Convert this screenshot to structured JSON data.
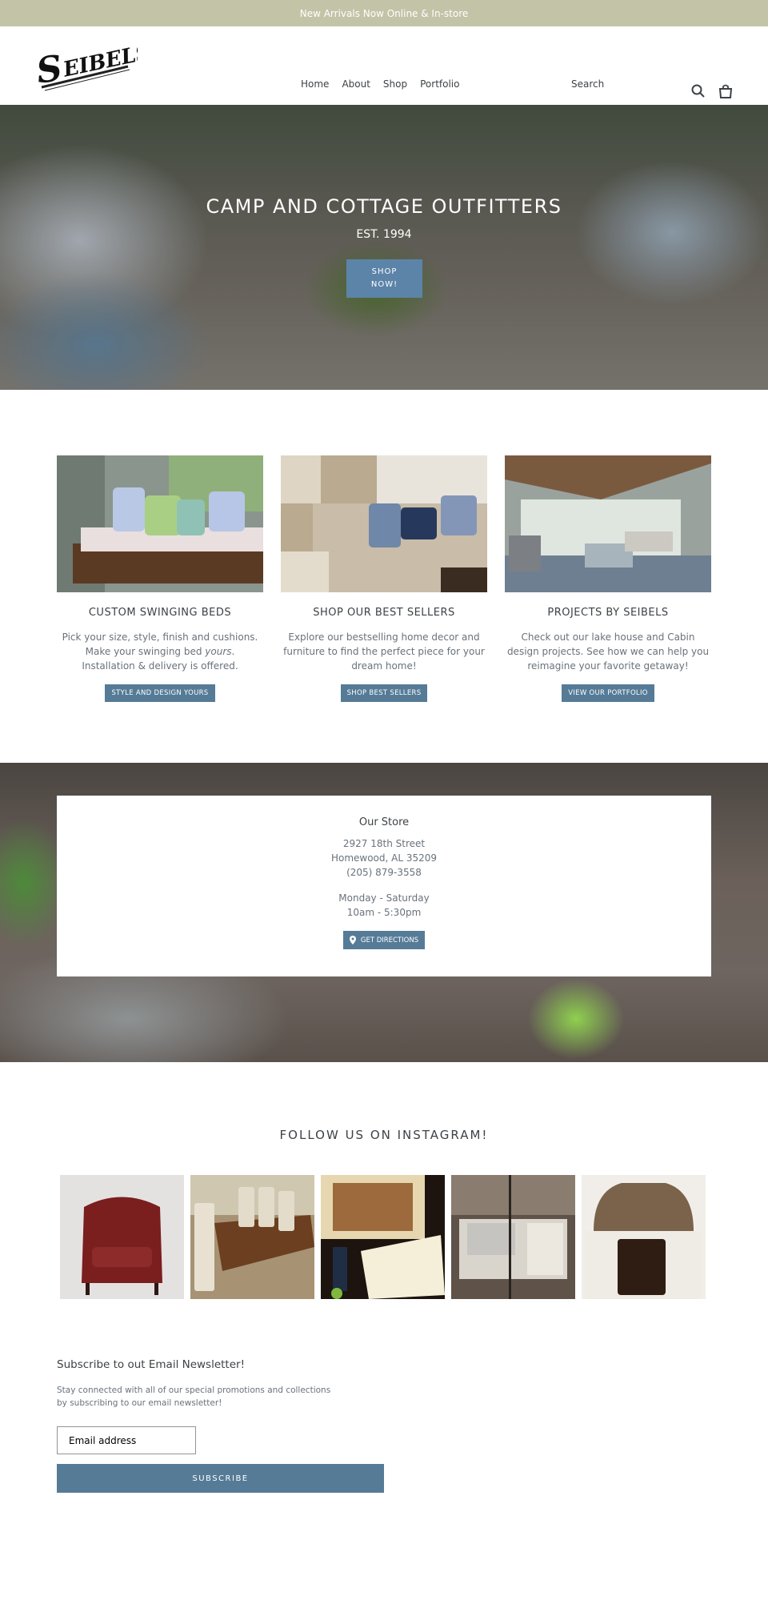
{
  "announcement": "New Arrivals Now Online & In-store",
  "header": {
    "logo_text": "Seibels",
    "nav": [
      "Home",
      "About",
      "Shop",
      "Portfolio"
    ],
    "search_label": "Search",
    "icons": [
      "search-icon",
      "cart-icon"
    ]
  },
  "hero": {
    "title": "CAMP AND COTTAGE OUTFITTERS",
    "subtitle": "EST. 1994",
    "button_line1": "SHOP",
    "button_line2": "NOW!"
  },
  "features": [
    {
      "title": "CUSTOM SWINGING BEDS",
      "text_before": "Pick your size, style, finish and cushions. Make your swinging bed ",
      "text_em": "yours",
      "text_after": ". Installation & delivery is offered.",
      "button": "STYLE AND DESIGN YOURS",
      "image": "swinging bed with pillows"
    },
    {
      "title": "SHOP OUR BEST SELLERS",
      "text_before": "Explore our bestselling home decor and furniture to find the perfect piece for your dream home!",
      "text_em": "",
      "text_after": "",
      "button": "SHOP BEST SELLERS",
      "image": "beige sofa with blue pillows"
    },
    {
      "title": "PROJECTS BY SEIBELS",
      "text_before": "Check out our lake house and Cabin design projects. See how we can help you reimagine your favorite getaway!",
      "text_em": "",
      "text_after": "",
      "button": "VIEW OUR PORTFOLIO",
      "image": "screened porch living room"
    }
  ],
  "store": {
    "title": "Our Store",
    "address1": "2927 18th Street",
    "address2": "Homewood, AL 35209",
    "phone": "(205) 879-3558",
    "days": "Monday - Saturday",
    "hours": "10am - 5:30pm",
    "button": "GET DIRECTIONS",
    "button_icon": "map-pin-icon"
  },
  "instagram": {
    "title": "FOLLOW US ON INSTAGRAM!",
    "images": [
      "red leather chair",
      "farmhouse dining table",
      "tailgate saturdays sign",
      "white porch swing",
      "wood headboard with pillows"
    ]
  },
  "newsletter": {
    "title": "Subscribe to out Email Newsletter!",
    "text_line1": "Stay connected with all of our special promotions and collections",
    "text_line2": "by subscribing to our email newsletter!",
    "email_placeholder": "Email address",
    "button": "SUBSCRIBE"
  },
  "colors": {
    "announcement_bg": "#c3c3a7",
    "button_blue": "#557b97",
    "hero_button": "#5c84a8"
  }
}
